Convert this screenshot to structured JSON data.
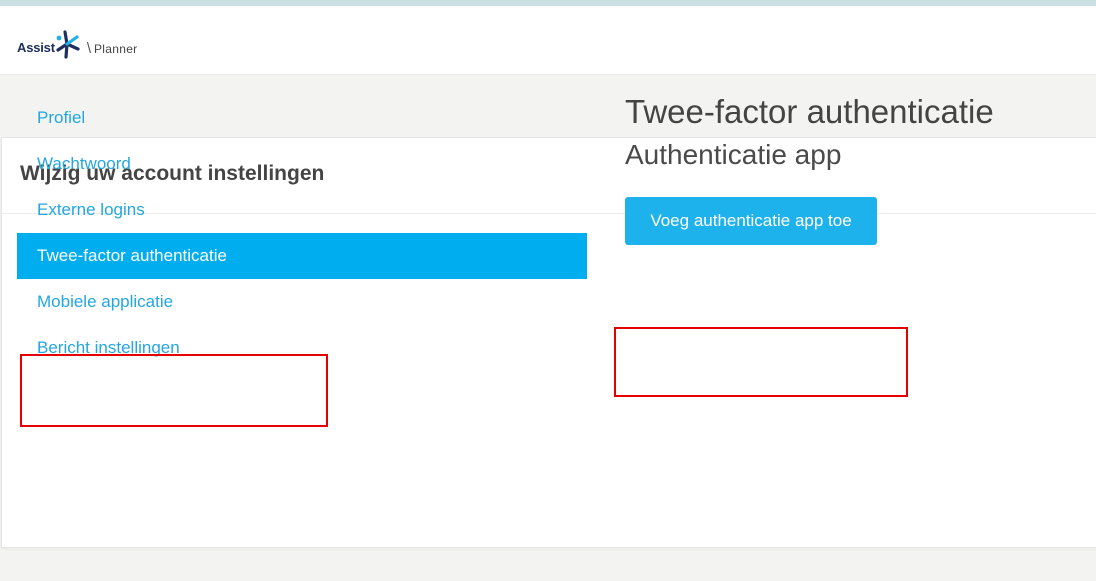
{
  "header": {
    "brand": "Assist",
    "separator": "\\",
    "product": "Planner",
    "logo_icon": "asterisk-star-icon"
  },
  "card": {
    "title": "Wijzig uw account instellingen"
  },
  "nav": {
    "items": [
      {
        "label": "Profiel",
        "active": false
      },
      {
        "label": "Wachtwoord",
        "active": false
      },
      {
        "label": "Externe logins",
        "active": false
      },
      {
        "label": "Twee-factor authenticatie",
        "active": true
      },
      {
        "label": "Mobiele applicatie",
        "active": false
      },
      {
        "label": "Bericht instellingen",
        "active": false
      }
    ]
  },
  "content": {
    "heading": "Twee-factor authenticatie",
    "subheading": "Authenticatie app",
    "add_button_label": "Voeg authenticatie app toe"
  },
  "colors": {
    "accent": "#00adee",
    "link": "#23a6e2",
    "button": "#1db2ec",
    "annotation": "#e60000",
    "brand": "#1d2f5e"
  }
}
